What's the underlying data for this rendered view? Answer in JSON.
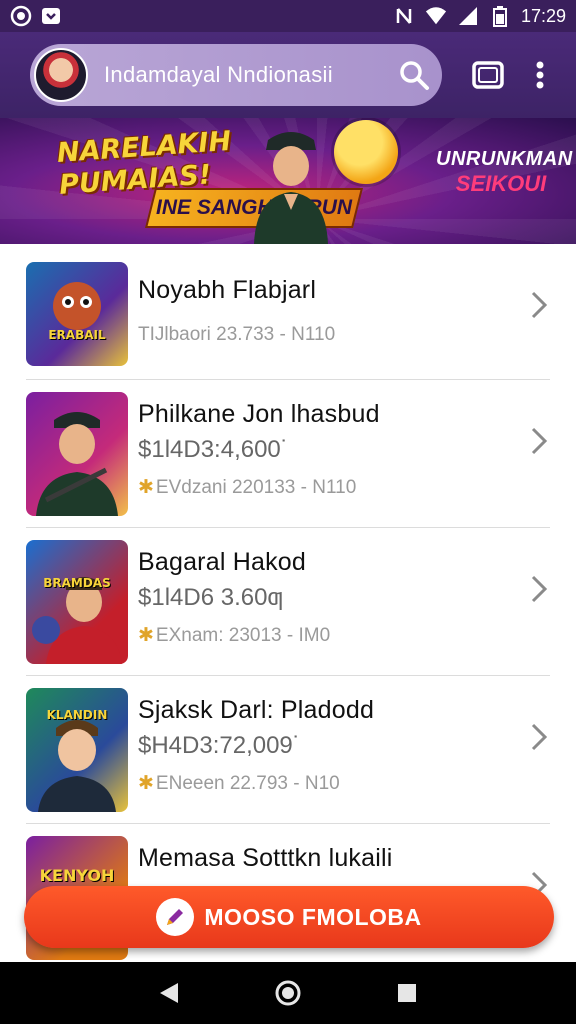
{
  "status_bar": {
    "time": "17:29",
    "icons": [
      "notification-icon-1",
      "notification-icon-2",
      "nfc-icon",
      "wifi-icon",
      "signal-icon",
      "battery-icon"
    ]
  },
  "app_bar": {
    "search_text": "Indamdayal Nndionasii",
    "icons": [
      "avatar",
      "search-icon",
      "cast-icon",
      "more-vert-icon"
    ]
  },
  "banner": {
    "title": "NARELAKIH PUMAIAS!",
    "ribbon": "INE SANGH PERUN",
    "sub_line1": "UNRUNKMAN",
    "sub_line2": "SEIKOUI"
  },
  "list": {
    "items": [
      {
        "title": "Noyabh Flabjarl",
        "price": "",
        "meta": "TIJlbaori 23.733 - N110",
        "thumb_label": "ERABAIL",
        "thumb_colors": [
          "#1a6fb0",
          "#e8c23a"
        ]
      },
      {
        "title": "Philkanе Jon lhasbud",
        "price": "$1l4D3:4,600˙",
        "meta": "EVdzani 220133 - N110",
        "thumb_label": "",
        "thumb_colors": [
          "#7a1fa0",
          "#f2c04a"
        ]
      },
      {
        "title": "Bagaral Hakod",
        "price": "$1l4D6 3.60ƣ",
        "meta": "EXnam: 23013 - IM0",
        "thumb_label": "BRAMDAS",
        "thumb_colors": [
          "#c41f2a",
          "#1a6fd0"
        ]
      },
      {
        "title": "Sjaksk Darl: Pladodd",
        "price": "$H4D3:72,009˙",
        "meta": "ENeeen 22.793 - N10",
        "thumb_label": "KLANDIN",
        "thumb_colors": [
          "#1f8a5a",
          "#e8c23a"
        ]
      },
      {
        "title": "Memasa Sotttkn lukaili",
        "price": "",
        "meta": "",
        "thumb_label": "KENYOH",
        "thumb_colors": [
          "#e07a12",
          "#7a1fa0"
        ]
      }
    ]
  },
  "fab": {
    "label": "MOOSO FMOLOBA",
    "color": "#e8381b"
  }
}
